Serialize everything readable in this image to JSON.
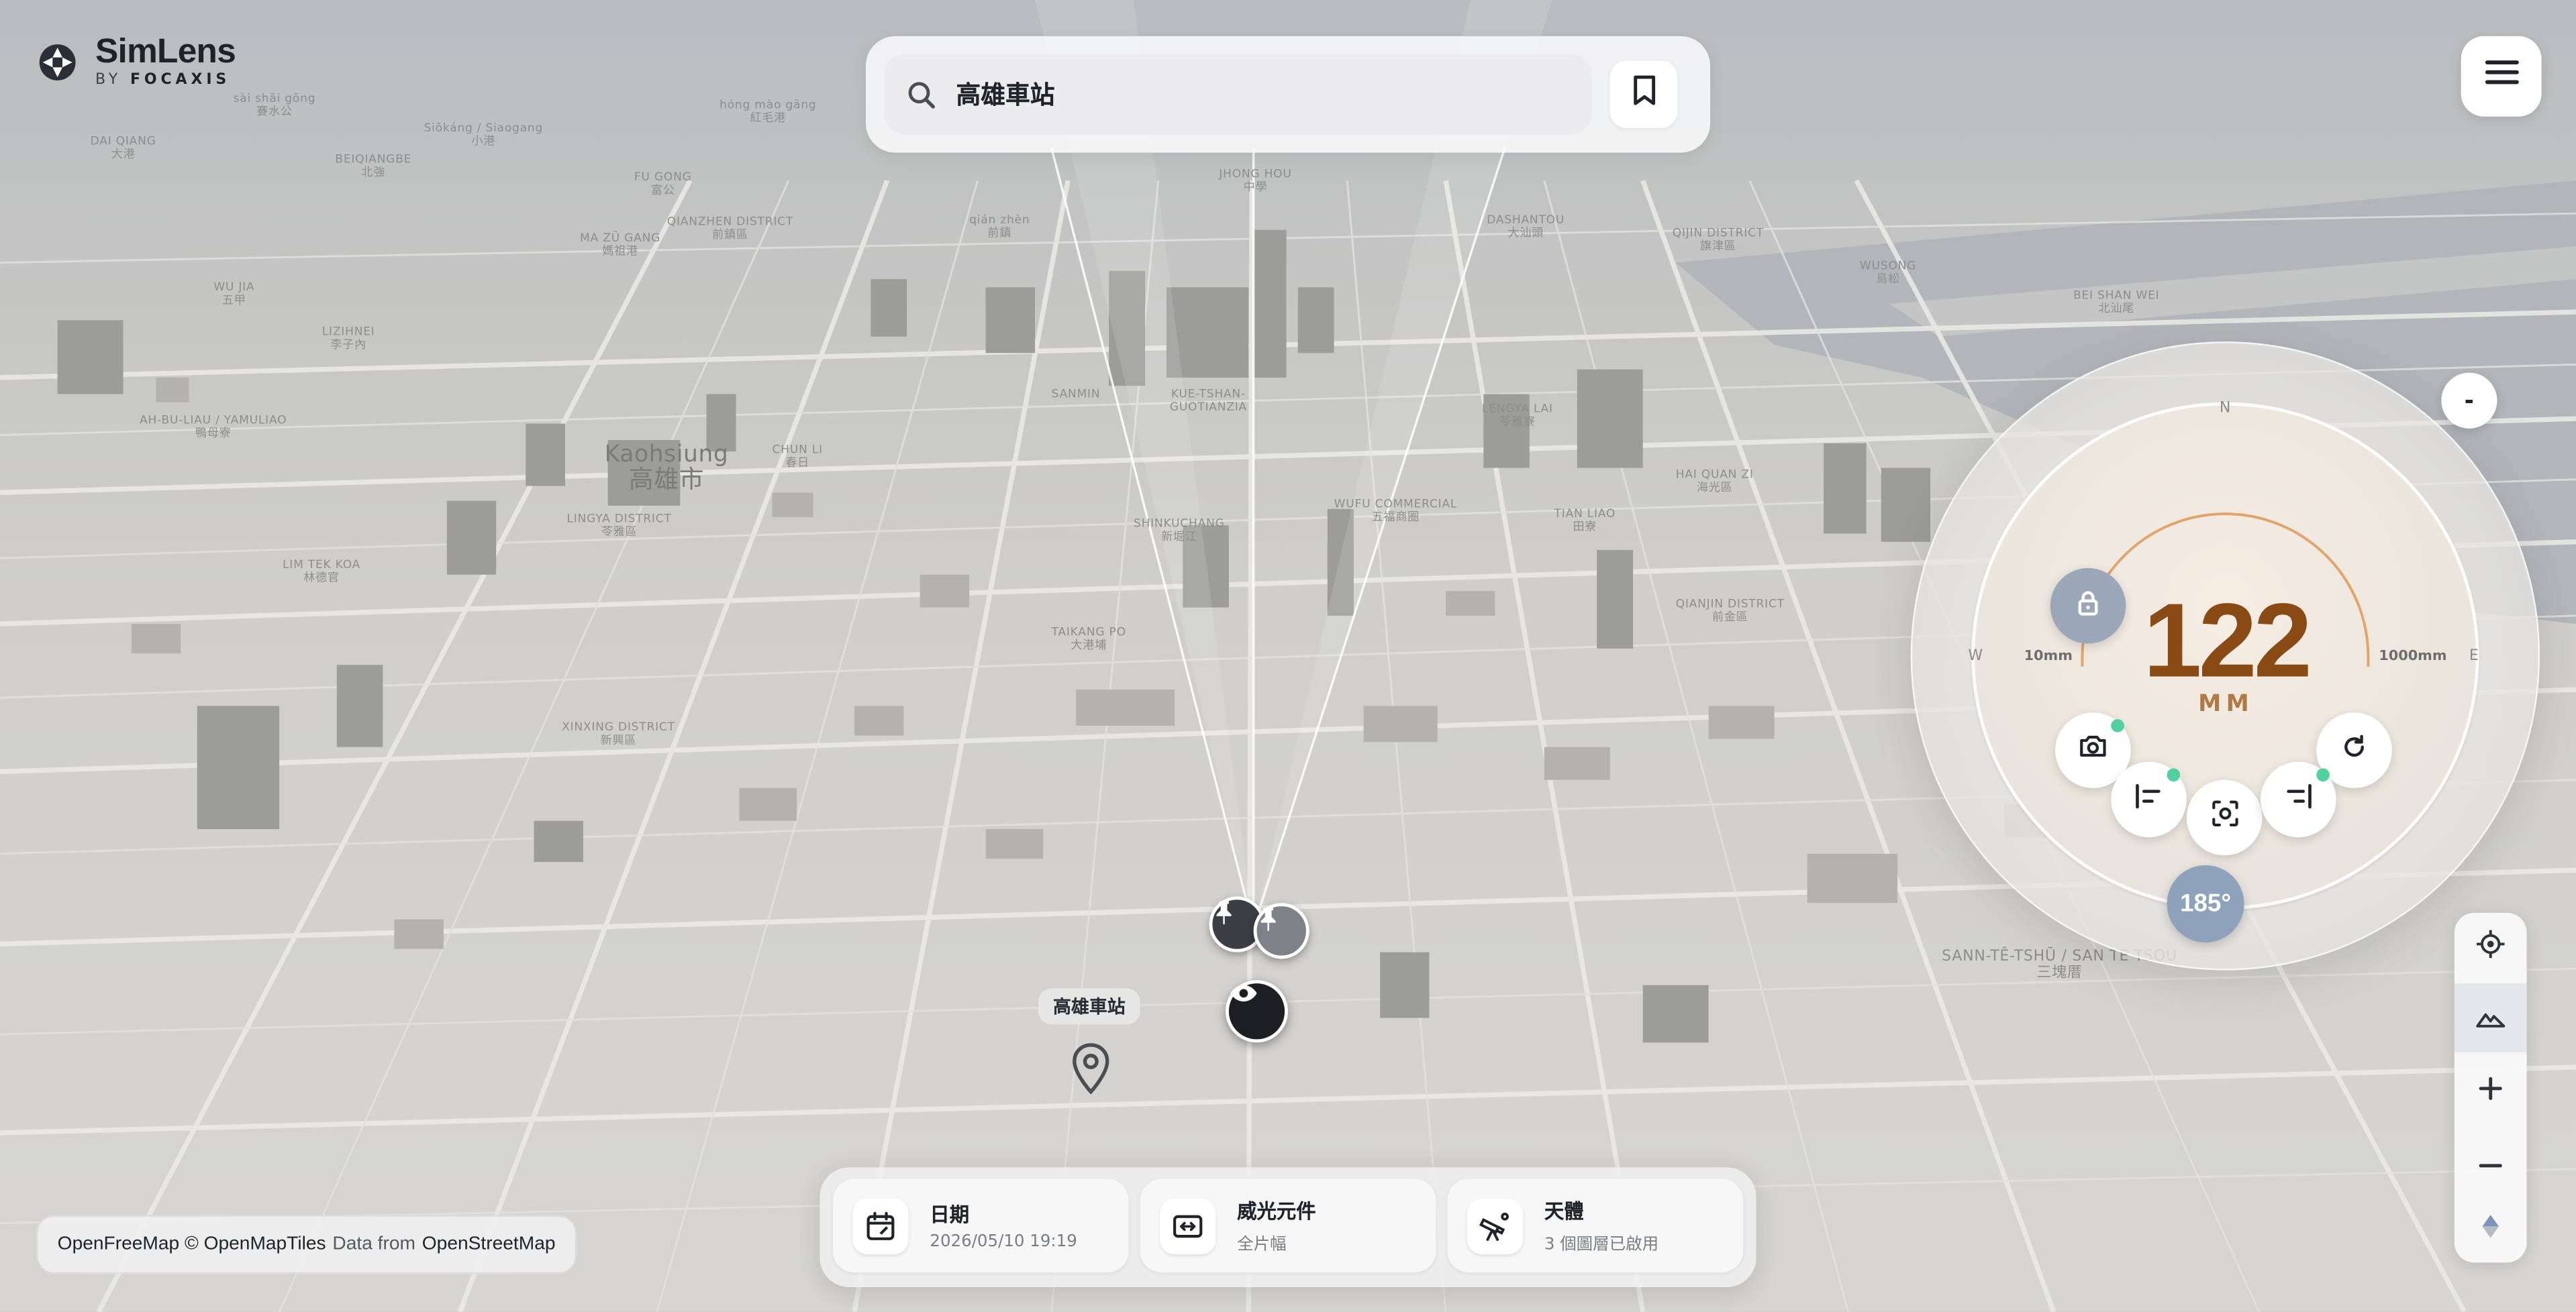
{
  "brand": {
    "name": "SimLens",
    "by": "BY",
    "company": "FOCAXIS"
  },
  "search": {
    "value": "高雄車站",
    "placeholder": ""
  },
  "map": {
    "labels": [
      {
        "en": "Kaohsiung",
        "zh": "高雄市",
        "cls": "big"
      },
      {
        "en": "LINGYA DISTRICT",
        "zh": "苓雅區"
      },
      {
        "en": "SANMIN",
        "zh": ""
      },
      {
        "en": "KUE-TSHAN-",
        "zh": "GUOTIANZIA"
      },
      {
        "en": "SHINKUCHANG",
        "zh": "新堀江"
      },
      {
        "en": "WUFU COMMERCIAL",
        "zh": "五福商圈"
      },
      {
        "en": "TAIKANG PO",
        "zh": "大港埔"
      },
      {
        "en": "XINXING DISTRICT",
        "zh": "新興區"
      },
      {
        "en": "LIM TEK KOA",
        "zh": "林德官"
      },
      {
        "en": "AH-BU-LIAU / YAMULIAO",
        "zh": "鴨母寮"
      },
      {
        "en": "LENGYA LAI",
        "zh": "苓雅寮"
      },
      {
        "en": "TIAN LIAO",
        "zh": "田寮"
      },
      {
        "en": "HAI QUAN ZI",
        "zh": "海光區"
      },
      {
        "en": "QIANJIN DISTRICT",
        "zh": "前金區"
      },
      {
        "en": "SANN-TÊ-TSHŪ / SAN TE TSOU",
        "zh": "三塊厝",
        "cls": "mid"
      },
      {
        "en": "qián zhèn",
        "zh": "前鎮"
      },
      {
        "en": "WUSONG",
        "zh": "烏松"
      },
      {
        "en": "BEI SHAN WEI",
        "zh": "北汕尾"
      },
      {
        "en": "QIJIN DISTRICT",
        "zh": "旗津區"
      },
      {
        "en": "DASHANTOU",
        "zh": "大汕頭"
      },
      {
        "en": "JHONG HOU",
        "zh": "中學"
      },
      {
        "en": "CHUN LI",
        "zh": "春日"
      },
      {
        "en": "LIZIHNEI",
        "zh": "李子內"
      },
      {
        "en": "MA ZŪ GANG",
        "zh": "媽祖港"
      },
      {
        "en": "QIANZHEN DISTRICT",
        "zh": "前鎮區"
      },
      {
        "en": "BEIQIANGBE",
        "zh": "北強"
      },
      {
        "en": "WU JIA",
        "zh": "五甲"
      },
      {
        "en": "FU GONG",
        "zh": "富公"
      },
      {
        "en": "DAI QIANG",
        "zh": "大港"
      },
      {
        "en": "Siōkáng / Siaogang",
        "zh": "小港"
      },
      {
        "en": "sài shāi gōng",
        "zh": "賽水公"
      },
      {
        "en": "hóng mào gāng",
        "zh": "紅毛港"
      }
    ],
    "place_label": "高雄車站"
  },
  "dial": {
    "compass": {
      "n": "N",
      "w": "W",
      "e": "E"
    },
    "focal_value": "122",
    "focal_unit": "MM",
    "range_min": "10mm",
    "range_max": "1000mm",
    "angle": "185°",
    "collapse_label": "-",
    "focal_fraction": 0.62
  },
  "bottom": {
    "date": {
      "title": "日期",
      "sub": "2026/05/10 19:19"
    },
    "lens": {
      "title": "威光元件",
      "sub": "全片幅"
    },
    "celestial": {
      "title": "天體",
      "sub": "3 個圖層已啟用"
    }
  },
  "attribution": {
    "a": "OpenFreeMap",
    "b": "© OpenMapTiles",
    "c": "Data from",
    "d": "OpenStreetMap"
  },
  "colors": {
    "accent": "#8a4a14",
    "dial_arc": "#e0a46c",
    "status_dot": "#4fd1a0",
    "angle_btn": "#8fa2bb"
  },
  "icons": [
    "logo-icon",
    "search-icon",
    "bookmark-icon",
    "menu-icon",
    "lock-icon",
    "camera-icon",
    "refresh-icon",
    "align-left-icon",
    "focus-icon",
    "align-right-icon",
    "locate-icon",
    "terrain-icon",
    "zoom-in-icon",
    "zoom-out-icon",
    "compass-icon",
    "pushpin-icon",
    "eye-icon",
    "location-pin-icon",
    "calendar-icon",
    "sensor-icon",
    "telescope-icon"
  ]
}
